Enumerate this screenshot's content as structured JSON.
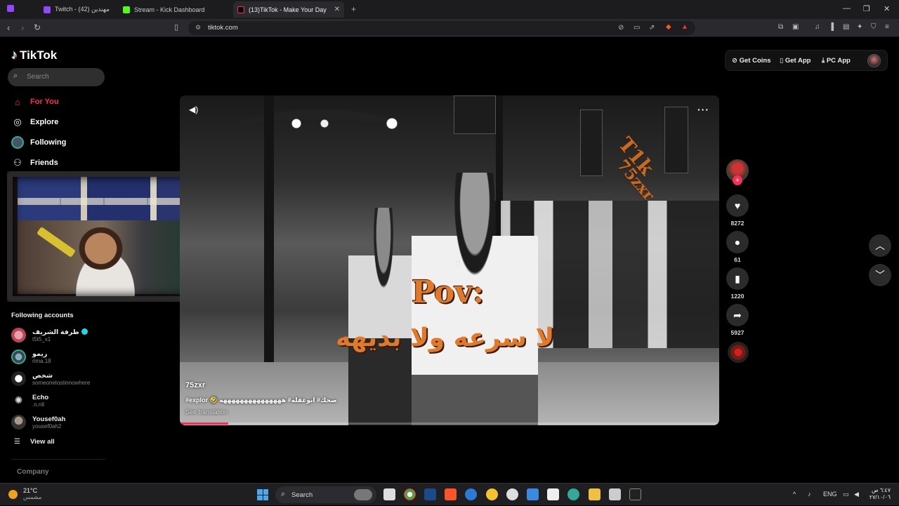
{
  "browser": {
    "tabs": [
      {
        "label": "Twitch - مهندين (42)"
      },
      {
        "label": "Stream - Kick Dashboard"
      },
      {
        "label": "(13)TikTok - Make Your Day",
        "active": true
      }
    ],
    "url": "tiktok.com"
  },
  "tiktok": {
    "logo": "TikTok",
    "search_placeholder": "Search",
    "nav": [
      {
        "label": "For You",
        "icon": "home-icon",
        "active": true
      },
      {
        "label": "Explore",
        "icon": "compass-icon"
      },
      {
        "label": "Following",
        "icon": "following-avatar-icon"
      },
      {
        "label": "Friends",
        "icon": "friends-icon"
      }
    ],
    "following_title": "Following accounts",
    "accounts": [
      {
        "name": "طرفة الشريف",
        "handle": "t5t5_x1",
        "verified": true
      },
      {
        "name": "ريمو",
        "handle": "rima.18"
      },
      {
        "name": "شخص",
        "handle": "someonelostinnowhere"
      },
      {
        "name": "Echo",
        "handle": ".n.nll"
      },
      {
        "name": "Yousef0ah",
        "handle": "yousef0ah2"
      }
    ],
    "view_all": "View all",
    "company": "Company",
    "top_actions": {
      "get_coins": "Get Coins",
      "get_app": "Get App",
      "pc_app": "PC App"
    },
    "video": {
      "overlay_pov": "Pov:",
      "overlay_arabic": "لا سرعه ولا بديهه",
      "watermark_1": "T1k",
      "watermark_2": "75zxr",
      "author": "75zxr",
      "caption": "#explor 🤣 ضحك# ابوعقله# هههههههههههههههه",
      "see_translation": "See translation",
      "progress_fraction": 0.09
    },
    "actions": {
      "likes": "8272",
      "comments": "61",
      "saves": "1220",
      "shares": "5927"
    }
  },
  "taskbar": {
    "weather_temp": "21°C",
    "weather_desc": "مشمس",
    "search_label": "Search",
    "lang": "ENG",
    "time": "٦:٤٧ ص",
    "date": "٢٧/١٠/٠٦"
  },
  "colors": {
    "tiktok_red": "#fe2c55",
    "overlay_orange": "#e07a2a"
  }
}
